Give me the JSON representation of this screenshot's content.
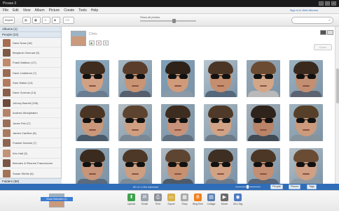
{
  "app": {
    "title": "Picasa 3"
  },
  "menu": {
    "items": [
      "File",
      "Edit",
      "View",
      "Album",
      "Picture",
      "Create",
      "Tools",
      "Help"
    ],
    "sign_in": "Sign in to Web Albums",
    "help_link": ""
  },
  "toolbar": {
    "import_label": "Import",
    "zoom_label": "Show all photos",
    "search_placeholder": ""
  },
  "sidebar": {
    "albums_header": "Albums (1)",
    "people_header": "People (24)",
    "folders_footer": "Folders (56)",
    "people": [
      {
        "label": "Dave Noss (18)",
        "color": "#a86c50"
      },
      {
        "label": "Benjamin Gennari (9)",
        "color": "#7e5a46"
      },
      {
        "label": "Frank Mattson (17)",
        "color": "#c08a6a"
      },
      {
        "label": "Dave Lindstrom (7)",
        "color": "#9b6b55"
      },
      {
        "label": "Sam Walsh (14)",
        "color": "#b37a5f"
      },
      {
        "label": "Dave Gorman (14)",
        "color": "#8a5e4a"
      },
      {
        "label": "Johnny Barrett (106)",
        "color": "#6d4c3b"
      },
      {
        "label": "Andrew Westphalen",
        "color": "#b58468"
      },
      {
        "label": "Jones Feld (7)",
        "color": "#9a6f58"
      },
      {
        "label": "James Carrillon (8)",
        "color": "#a77a61"
      },
      {
        "label": "Frankie Darvish (7)",
        "color": "#8d6450"
      },
      {
        "label": "Kim Hall (3)",
        "color": "#c29377"
      },
      {
        "label": "Brenden & Rhonne Francesconi",
        "color": "#7a5545"
      },
      {
        "label": "Susan Stehle (6)",
        "color": "#a37257"
      },
      {
        "label": "Chris (16)",
        "color": "#5a7fa6",
        "selected": true
      }
    ]
  },
  "person": {
    "name": "Chris",
    "done_label": "Done"
  },
  "faces": [
    {
      "bg": "#8fb0c6",
      "hair": "#3e2c1f",
      "skin": "#d2a184",
      "shirt": "#6a7d90"
    },
    {
      "bg": "#a7bac6",
      "hair": "#5a3e2b",
      "skin": "#c99474",
      "shirt": "#555f6e"
    },
    {
      "bg": "#7fa0b8",
      "hair": "#2e2219",
      "skin": "#cf9b7b",
      "shirt": "#8a9aa8"
    },
    {
      "bg": "#b8c6cf",
      "hair": "#4b3626",
      "skin": "#c48e6f",
      "shirt": "#56697c"
    },
    {
      "bg": "#98a9b6",
      "hair": "#6b4b32",
      "skin": "#d4a688",
      "shirt": "#b9b9b9"
    },
    {
      "bg": "#9db4c2",
      "hair": "#3a2a1e",
      "skin": "#c28f72",
      "shirt": "#5b6470"
    },
    {
      "bg": "#a0b2bd",
      "hair": "#4a3525",
      "skin": "#c9987a",
      "shirt": "#495a6a"
    },
    {
      "bg": "#b4bec4",
      "hair": "#5c4431",
      "skin": "#cf9f82",
      "shirt": "#7a8896"
    },
    {
      "bg": "#90a5b4",
      "hair": "#3d2d20",
      "skin": "#c7927a",
      "shirt": "#5f6f80"
    },
    {
      "bg": "#aebdc6",
      "hair": "#4f3a29",
      "skin": "#d0a386",
      "shirt": "#6d7a88"
    },
    {
      "bg": "#a4b0b8",
      "hair": "#2f241b",
      "skin": "#b98468",
      "shirt": "#3f4a55"
    },
    {
      "bg": "#9fb3bf",
      "hair": "#574029",
      "skin": "#cc9a7c",
      "shirt": "#86929c"
    },
    {
      "bg": "#8ea6b7",
      "hair": "#3b2b1f",
      "skin": "#c6957a",
      "shirt": "#5a6b7d"
    },
    {
      "bg": "#a9b8c2",
      "hair": "#4d3827",
      "skin": "#cd9e80",
      "shirt": "#7c8b98"
    },
    {
      "bg": "#b0bac0",
      "hair": "#5e4532",
      "skin": "#c69171",
      "shirt": "#4d5a67"
    },
    {
      "bg": "#99abb8",
      "hair": "#3e2f22",
      "skin": "#d2a285",
      "shirt": "#6b7b8b"
    },
    {
      "bg": "#a3b5c1",
      "hair": "#4c3726",
      "skin": "#c58f73",
      "shirt": "#58677a"
    },
    {
      "bg": "#b6c1c8",
      "hair": "#6a4c35",
      "skin": "#cfa084",
      "shirt": "#8d99a3"
    }
  ],
  "statusbar": {
    "text": "80 of 1,264 selected",
    "people_label": "People",
    "places_label": "Places",
    "tags_label": "Tags"
  },
  "tray": {
    "selection_label": "Show Selection (1)",
    "actions": [
      {
        "label": "Upload",
        "icon": "upload-icon",
        "color": "#3fa34d",
        "glyph": "⬆"
      },
      {
        "label": "Email",
        "icon": "email-icon",
        "color": "#9aa3ad",
        "glyph": "✉"
      },
      {
        "label": "Print",
        "icon": "print-icon",
        "color": "#8a8f96",
        "glyph": "⎙"
      },
      {
        "label": "Export",
        "icon": "export-icon",
        "color": "#d8b04a",
        "glyph": "▭"
      },
      {
        "label": "Shop",
        "icon": "shop-icon",
        "color": "#a8a8a8",
        "glyph": "▦"
      },
      {
        "label": "BlogThis!",
        "icon": "blogger-icon",
        "color": "#f07f1a",
        "glyph": "B"
      },
      {
        "label": "Collage",
        "icon": "collage-icon",
        "color": "#5b7fb0",
        "glyph": "▤"
      },
      {
        "label": "Movie",
        "icon": "movie-icon",
        "color": "#6a6a6a",
        "glyph": "▶"
      },
      {
        "label": "Geo-Tag",
        "icon": "geotag-icon",
        "color": "#4a78c2",
        "glyph": "◉"
      }
    ]
  }
}
